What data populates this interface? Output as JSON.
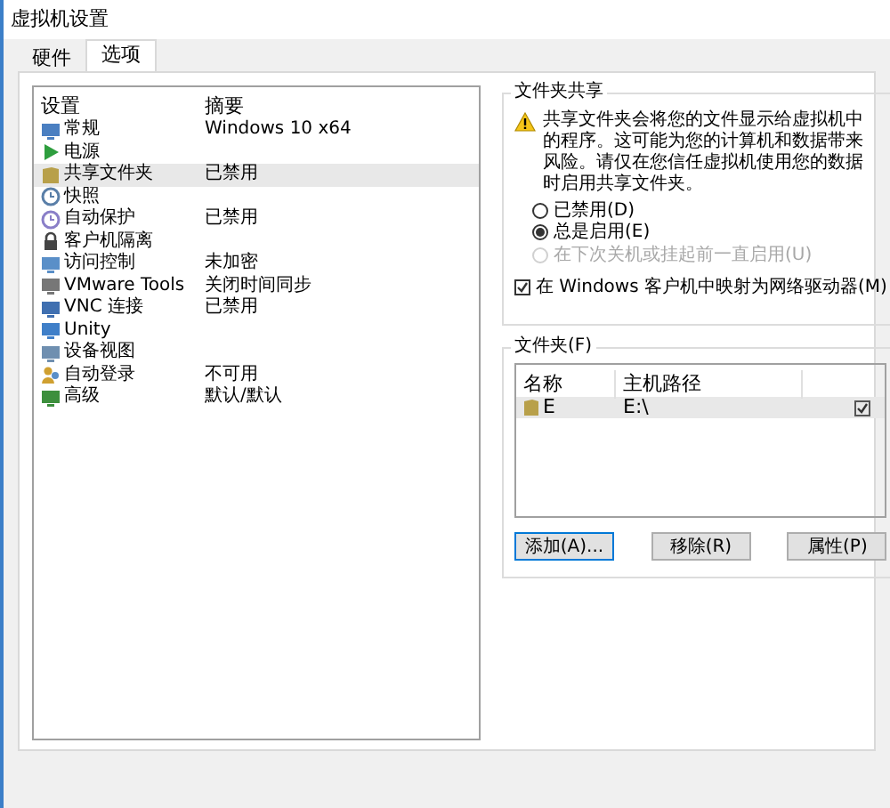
{
  "window": {
    "title": "虚拟机设置"
  },
  "tabs": [
    {
      "label": "硬件",
      "selected": false
    },
    {
      "label": "选项",
      "selected": true
    }
  ],
  "settings_list": {
    "columns": [
      "设置",
      "摘要"
    ],
    "rows": [
      {
        "name": "常规",
        "summary": "Windows 10 x64",
        "selected": false
      },
      {
        "name": "电源",
        "selected": false
      },
      {
        "name": "共享文件夹",
        "summary": "已禁用",
        "selected": true
      },
      {
        "name": "快照",
        "selected": false
      },
      {
        "name": "自动保护",
        "summary": "已禁用",
        "selected": false
      },
      {
        "name": "客户机隔离",
        "selected": false
      },
      {
        "name": "访问控制",
        "summary": "未加密",
        "selected": false
      },
      {
        "name": "VMware Tools",
        "summary": "关闭时间同步",
        "selected": false
      },
      {
        "name": "VNC 连接",
        "summary": "已禁用",
        "selected": false
      },
      {
        "name": "Unity",
        "selected": false
      },
      {
        "name": "设备视图",
        "selected": false
      },
      {
        "name": "自动登录",
        "summary": "不可用",
        "selected": false
      },
      {
        "name": "高级",
        "summary": "默认/默认",
        "selected": false
      }
    ]
  },
  "file_sharing": {
    "title": "文件夹共享",
    "warning": "共享文件夹会将您的文件显示给虚拟机中的程序。这可能为您的计算机和数据带来风险。请仅在您信任虚拟机使用您的数据时启用共享文件夹。",
    "options": [
      {
        "label": "已禁用(D)",
        "selected": false,
        "disabled": false
      },
      {
        "label": "总是启用(E)",
        "selected": true,
        "disabled": false
      },
      {
        "label": "在下次关机或挂起前一直启用(U)",
        "selected": false,
        "disabled": true
      }
    ],
    "map_drive": {
      "label": "在 Windows 客户机中映射为网络驱动器(M)",
      "checked": true
    }
  },
  "folders": {
    "title": "文件夹(F)",
    "columns": [
      "名称",
      "主机路径"
    ],
    "rows": [
      {
        "name": "E",
        "path": "E:\\",
        "checked": true,
        "selected": true
      }
    ],
    "buttons": [
      {
        "label": "添加(A)...",
        "default": true
      },
      {
        "label": "移除(R)",
        "default": false
      },
      {
        "label": "属性(P)",
        "default": false
      }
    ]
  }
}
